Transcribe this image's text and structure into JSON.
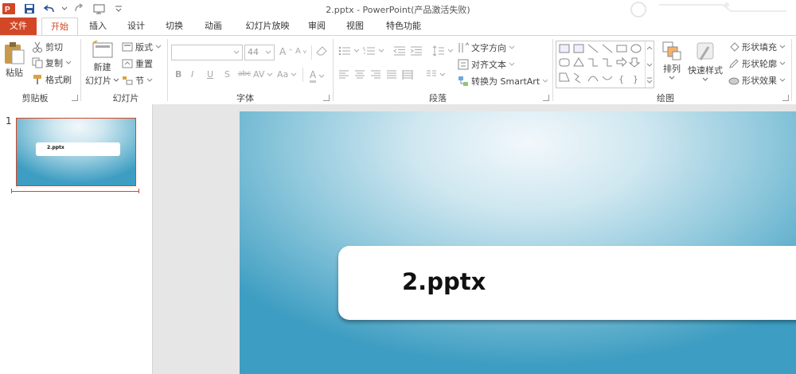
{
  "window": {
    "title": "2.pptx - PowerPoint(产品激活失败)"
  },
  "tabs": [
    {
      "label": "文件"
    },
    {
      "label": "开始"
    },
    {
      "label": "插入"
    },
    {
      "label": "设计"
    },
    {
      "label": "切换"
    },
    {
      "label": "动画"
    },
    {
      "label": "幻灯片放映"
    },
    {
      "label": "审阅"
    },
    {
      "label": "视图"
    },
    {
      "label": "特色功能"
    }
  ],
  "clipboard": {
    "paste": "粘贴",
    "cut": "剪切",
    "copy": "复制",
    "format_painter": "格式刷",
    "label": "剪贴板"
  },
  "slides_group": {
    "new_slide_1": "新建",
    "new_slide_2": "幻灯片",
    "layout": "版式",
    "reset": "重置",
    "section": "节",
    "label": "幻灯片"
  },
  "font": {
    "size": "44",
    "label": "字体",
    "change_case": "Aa"
  },
  "paragraph": {
    "text_direction": "文字方向",
    "align_text": "对齐文本",
    "convert_smartart": "转换为 SmartArt",
    "label": "段落"
  },
  "drawing": {
    "arrange": "排列",
    "quick_styles": "快速样式",
    "shape_fill": "形状填充",
    "shape_outline": "形状轮廓",
    "shape_effects": "形状效果",
    "label": "绘图"
  },
  "thumbnail": {
    "number": "1",
    "title": "2.pptx"
  },
  "slide": {
    "title": "2.pptx"
  },
  "colors": {
    "accent": "#d24726",
    "slide_dark": "#3d9dc2"
  }
}
